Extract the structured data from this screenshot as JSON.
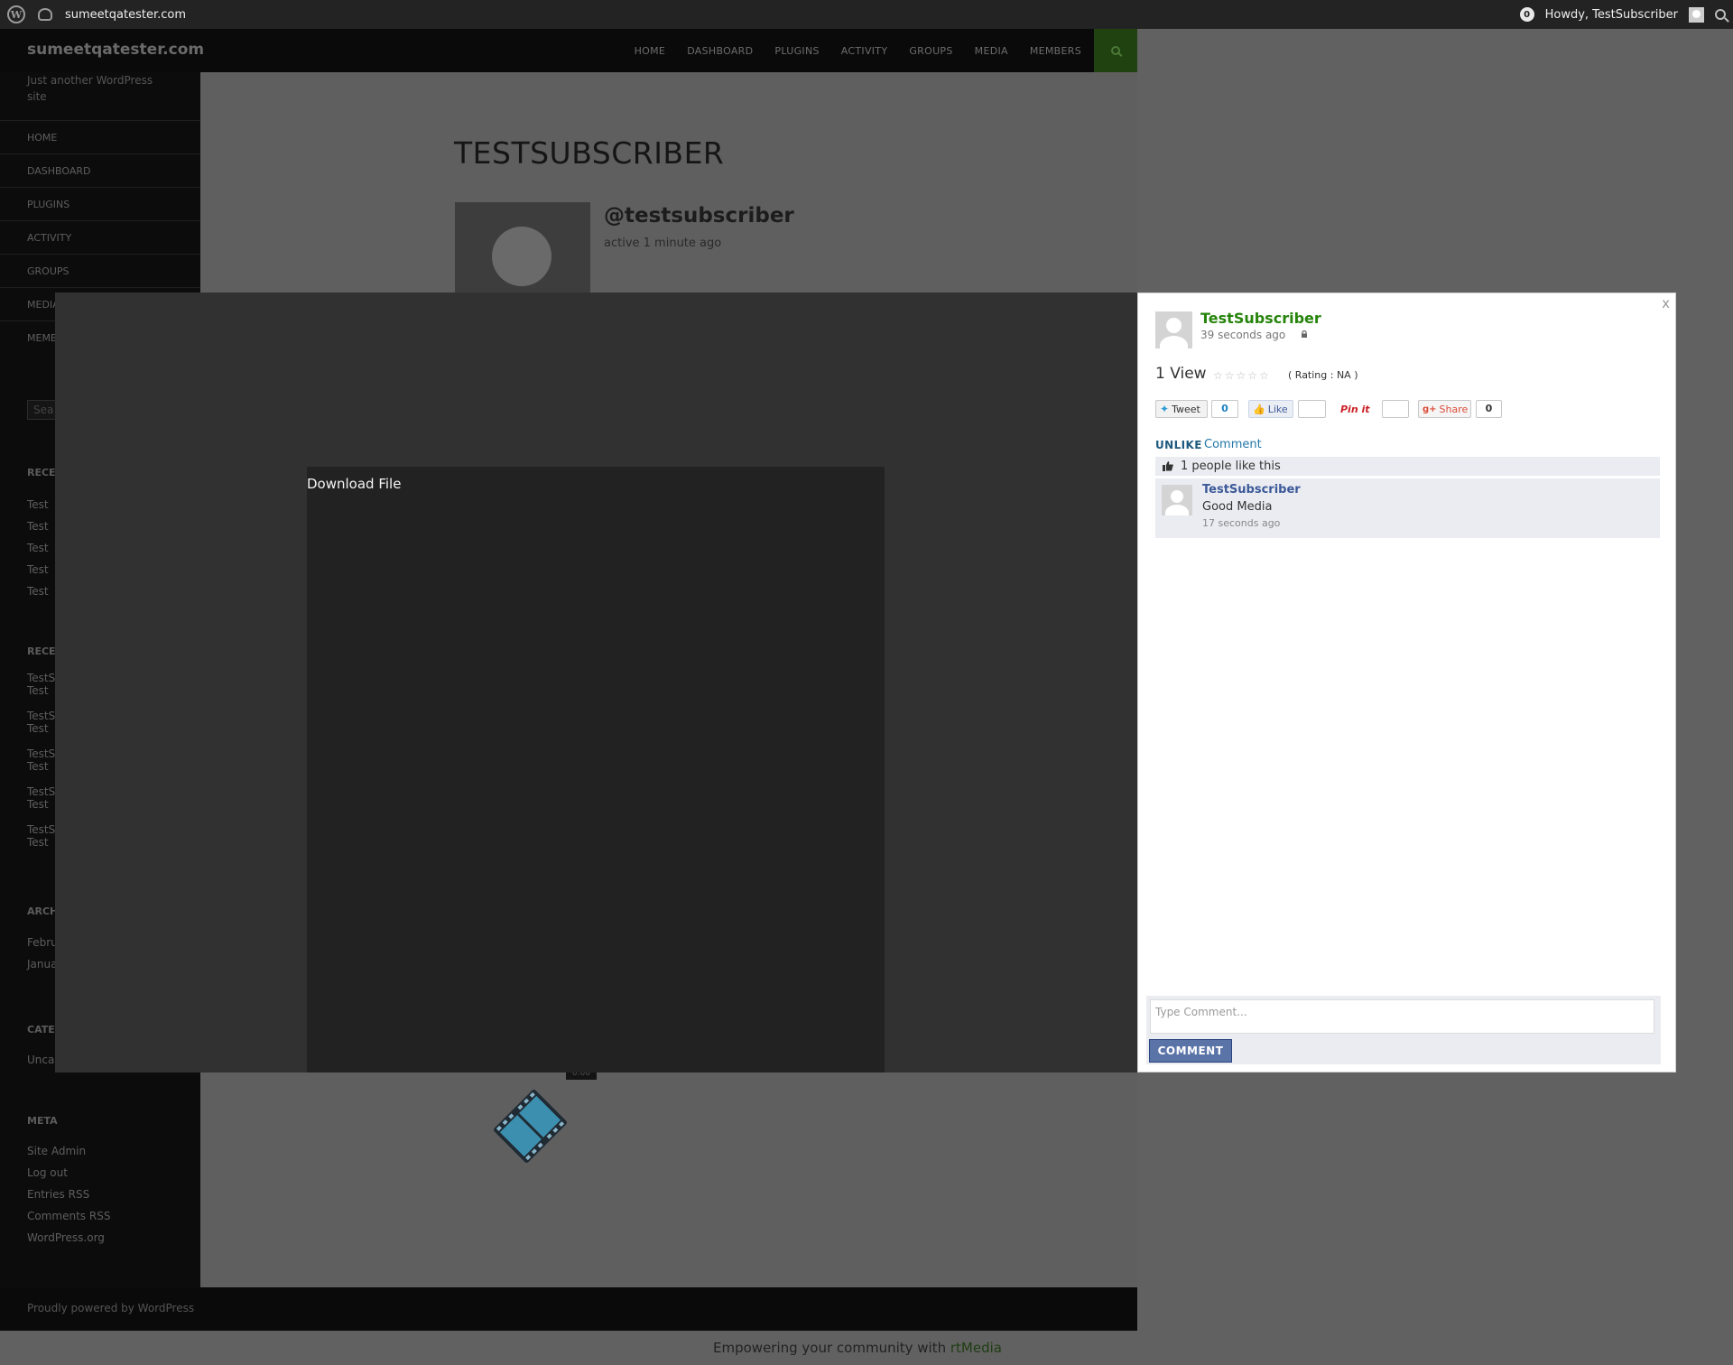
{
  "admin_bar": {
    "site_name": "sumeetqatester.com",
    "notification_count": "0",
    "greeting": "Howdy, TestSubscriber"
  },
  "site": {
    "title": "sumeetqatester.com",
    "tagline": "Just another WordPress site",
    "primary_nav": [
      "HOME",
      "DASHBOARD",
      "PLUGINS",
      "ACTIVITY",
      "GROUPS",
      "MEDIA",
      "MEMBERS"
    ],
    "side_nav": [
      "HOME",
      "DASHBOARD",
      "PLUGINS",
      "ACTIVITY",
      "GROUPS",
      "MEDIA",
      "MEMB"
    ],
    "side_search_placeholder": "Sea",
    "widgets": {
      "recent_posts": {
        "title": "RECE",
        "items": [
          "Test",
          "Test",
          "Test",
          "Test",
          "Test"
        ]
      },
      "recent_comments": {
        "title": "RECE",
        "items": [
          [
            "TestS",
            "Test"
          ],
          [
            "TestS",
            "Test"
          ],
          [
            "TestS",
            "Test"
          ],
          [
            "TestS",
            "Test"
          ],
          [
            "TestS",
            "Test"
          ]
        ]
      },
      "archives": {
        "title": "ARCH",
        "items": [
          "Febru",
          "Janua"
        ]
      },
      "categories": {
        "title": "CATE",
        "items": [
          "Unca"
        ]
      },
      "meta": {
        "title": "META",
        "items": [
          "Site Admin",
          "Log out",
          "Entries RSS",
          "Comments RSS",
          "WordPress.org"
        ]
      }
    },
    "footer": "Proudly powered by WordPress",
    "rtmedia_prefix": "Empowering your community with ",
    "rtmedia_link": "rtMedia"
  },
  "profile": {
    "name": "TESTSUBSCRIBER",
    "handle": "@testsubscriber",
    "active": "active 1 minute ago",
    "media_time_badge": "0:00"
  },
  "lightbox": {
    "download_label": "Download File",
    "close_label": "x",
    "author": "TestSubscriber",
    "time": "39 seconds ago",
    "views": "1 View",
    "rating_label": "( Rating : NA )",
    "rating_value": 0,
    "rating_max": 5,
    "share": {
      "tweet_label": "Tweet",
      "tweet_count": "0",
      "like_label": "Like",
      "like_count": "",
      "pin_label": "Pin it",
      "pin_count": "",
      "gplus_label": "Share",
      "gplus_count": "0"
    },
    "unlike_label": "UNLIKE",
    "comment_link_label": "Comment",
    "likes_text": "1 people like this",
    "comments": [
      {
        "author": "TestSubscriber",
        "text": "Good Media",
        "time": "17 seconds ago"
      }
    ],
    "comment_placeholder": "Type Comment...",
    "comment_submit": "COMMENT"
  }
}
